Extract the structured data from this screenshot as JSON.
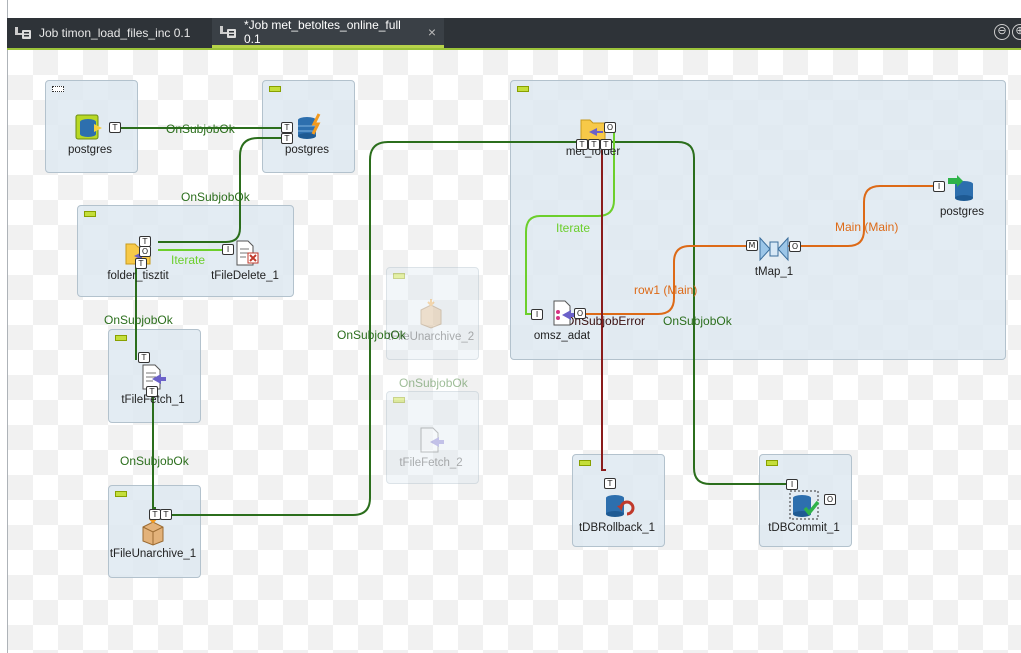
{
  "tabs": [
    {
      "label": "Job timon_load_files_inc 0.1"
    },
    {
      "label": "*Job met_betoltes_online_full 0.1",
      "close": "×"
    }
  ],
  "tabbar_buttons": [
    "⊖",
    "⊕"
  ],
  "components": {
    "postgres_1": "postgres",
    "postgres_2": "postgres",
    "folder": "folder_tisztit",
    "file_delete": "tFileDelete_1",
    "file_fetch_1": "tFileFetch_1",
    "file_unarchive_1": "tFileUnarchive_1",
    "file_unarchive_2": "tFileUnarchive_2",
    "file_fetch_2": "tFileFetch_2",
    "met_folder": "met_folder",
    "omsz_adat": "omsz_adat",
    "tmap": "tMap_1",
    "postgres_3": "postgres",
    "rollback": "tDBRollback_1",
    "commit": "tDBCommit_1"
  },
  "link_labels": {
    "ok_1": "OnSubjobOk",
    "ok_2": "OnSubjobOk",
    "iterate_1": "Iterate",
    "ok_3": "OnSubjobOk",
    "ok_4": "OnSubjobOk",
    "ok_5": "OnSubjobOk",
    "ok_6": "OnSubjobOk",
    "iterate_2": "Iterate",
    "main_1": "Main (Main)",
    "row1": "row1 (Main)",
    "error": "OnSubjobError",
    "ok_7": "OnSubjobOk"
  },
  "colors": {
    "subjob_ok": "#2b6e1c",
    "iterate": "#6ccf2c",
    "main": "#dd6a17",
    "error": "#8a1c1c"
  }
}
